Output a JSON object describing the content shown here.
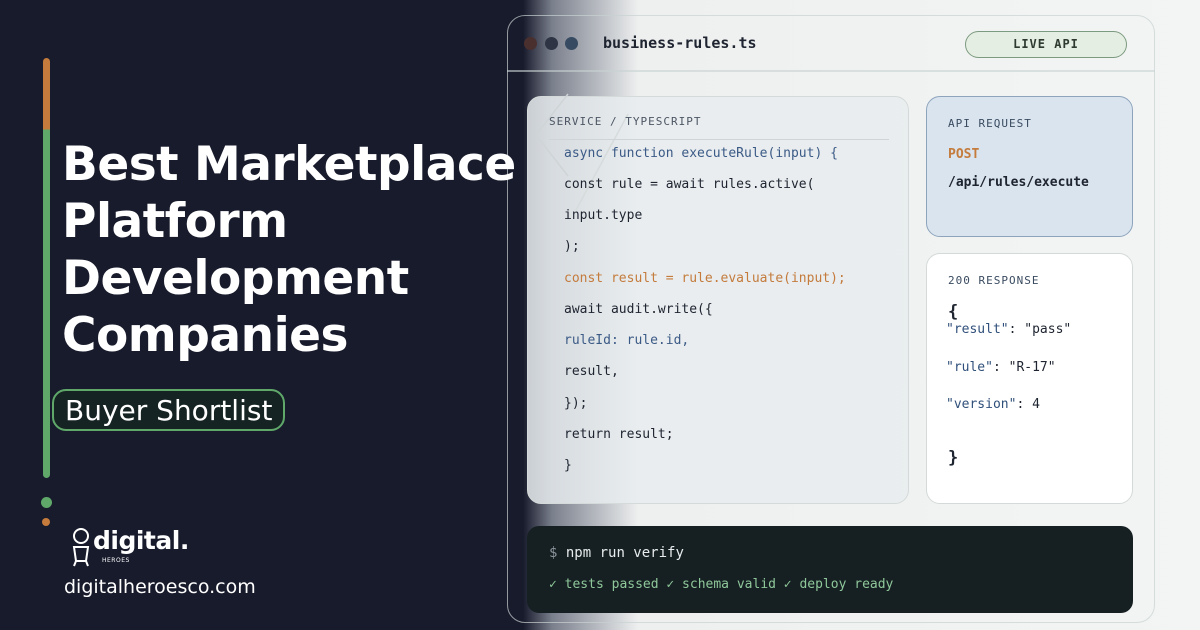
{
  "headline": {
    "line1": "Best Marketplace",
    "line2": "Platform",
    "line3": "Development",
    "line4": "Companies"
  },
  "badge": "Buyer Shortlist",
  "brand": {
    "logo_text": "digital.",
    "logo_subtext": "HEROES",
    "website": "digitalheroesco.com"
  },
  "editor": {
    "filename": "business-rules.ts",
    "status_pill": "LIVE API",
    "code_panel": {
      "label": "SERVICE / TYPESCRIPT",
      "lines": [
        "async function executeRule(input) {",
        "const rule = await rules.active(",
        "input.type",
        ");",
        "const result = rule.evaluate(input);",
        "await audit.write({",
        "ruleId: rule.id,",
        "result,",
        "});",
        "return result;",
        "}"
      ]
    },
    "request_panel": {
      "label": "API REQUEST",
      "method": "POST",
      "path": "/api/rules/execute"
    },
    "response_panel": {
      "label": "200 RESPONSE",
      "open_brace": "{",
      "fields": [
        {
          "key": "\"result\"",
          "value": ": \"pass\""
        },
        {
          "key": "\"rule\"",
          "value": ": \"R-17\""
        },
        {
          "key": "\"version\"",
          "value": ": 4"
        }
      ],
      "close_brace": "}"
    },
    "terminal": {
      "prompt": "$",
      "command": " npm run verify",
      "output": "✓ tests passed ✓ schema valid ✓ deploy ready"
    }
  },
  "colors": {
    "background": "#181b2c",
    "accent_green": "#5fa86a",
    "accent_orange": "#c47b3c",
    "code_blue": "#3b5a86"
  }
}
